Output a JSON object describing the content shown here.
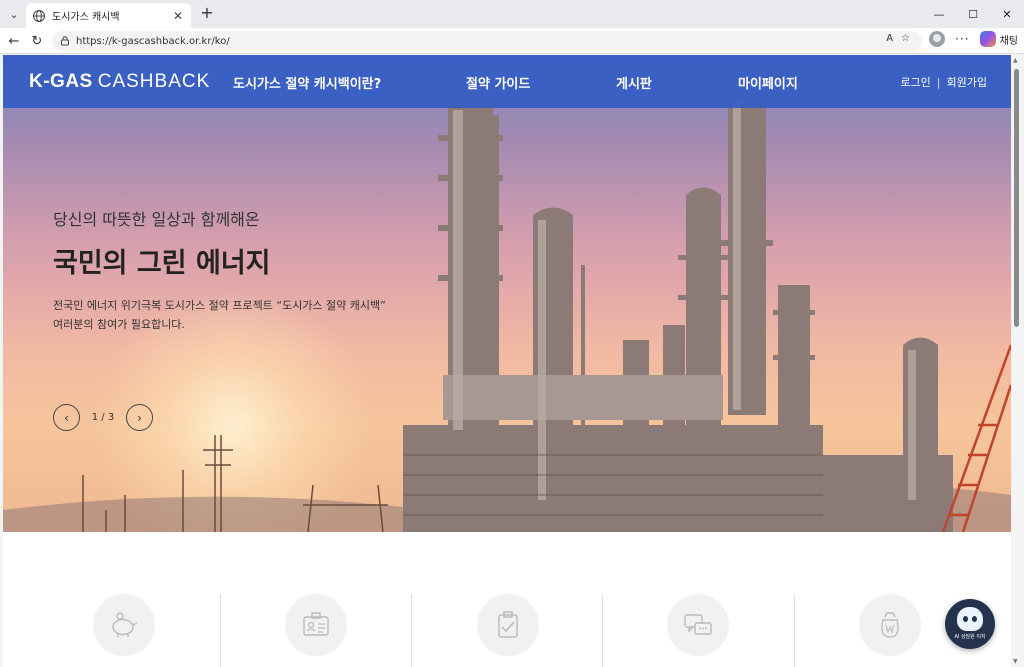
{
  "browser": {
    "tab_title": "도시가스 캐시백",
    "url": "https://k-gascashback.or.kr/ko/",
    "reader_label": "A",
    "copilot_label": "채팅"
  },
  "site": {
    "brand_bold": "K-GAS",
    "brand_light": "CASHBACK",
    "nav": [
      "도시가스 절약 캐시백이란?",
      "절약 가이드",
      "게시판",
      "마이페이지"
    ],
    "login": "로그인",
    "auth_sep": "|",
    "signup": "회원가입",
    "accent": "#345cc4"
  },
  "hero": {
    "subtitle": "당신의 따뜻한 일상과 함께해온",
    "title": "국민의 그린 에너지",
    "desc_line1": "전국민 에너지 위기극복 도시가스 절약 프로젝트 “도시가스 절약 캐시백”",
    "desc_line2": "여러분의 참여가 필요합니다.",
    "page_indicator": "1 / 3"
  },
  "services": {
    "icons": [
      "piggy-bank-icon",
      "id-card-icon",
      "clipboard-check-icon",
      "chat-bubbles-icon",
      "money-bag-icon"
    ]
  },
  "chatbot": {
    "label": "AI 상담원 이지"
  }
}
